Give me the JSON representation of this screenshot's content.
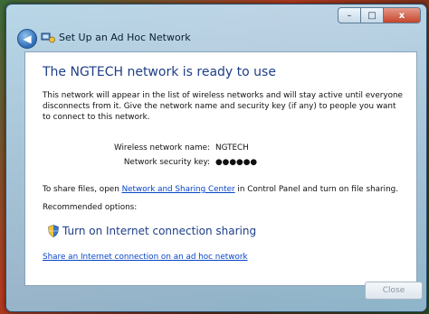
{
  "window": {
    "title": "Set Up an Ad Hoc Network",
    "min_glyph": "–",
    "max_glyph": "□",
    "close_glyph": "x"
  },
  "content": {
    "heading": "The NGTECH network is ready to use",
    "description": "This network will appear in the list of wireless networks and will stay active until everyone disconnects from it. Give the network name and security key (if any) to people you want to connect to this network.",
    "network_name_label": "Wireless network name:",
    "network_name_value": "NGTECH",
    "security_key_label": "Network security key:",
    "security_key_value": "●●●●●●",
    "share_prefix": "To share files, open ",
    "share_link": "Network and Sharing Center",
    "share_suffix": " in Control Panel and turn on file sharing.",
    "recommended_label": "Recommended options:",
    "ics_option": "Turn on Internet connection sharing",
    "share_adhoc_link": "Share an Internet connection on an ad hoc network"
  },
  "buttons": {
    "close": "Close"
  },
  "icons": {
    "back": "back-arrow-icon",
    "wizard": "network-wizard-icon",
    "shield": "uac-shield-icon"
  }
}
